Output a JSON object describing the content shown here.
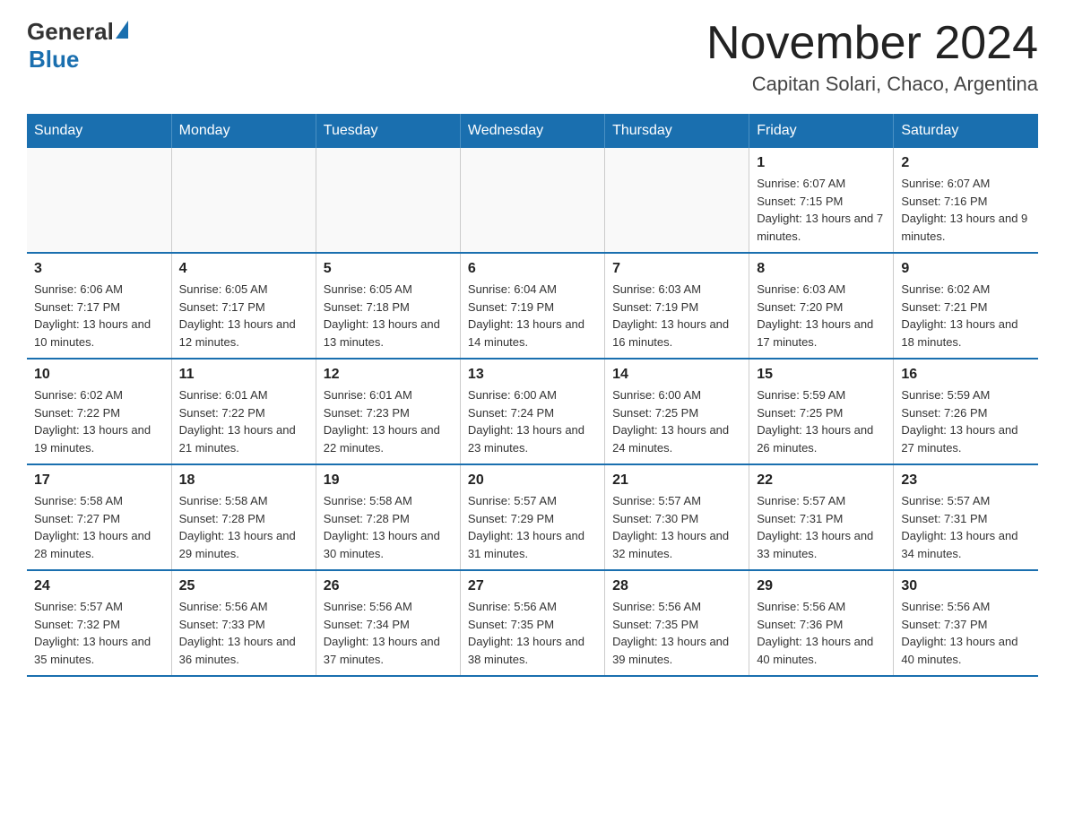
{
  "logo": {
    "general": "General",
    "blue": "Blue"
  },
  "title": "November 2024",
  "location": "Capitan Solari, Chaco, Argentina",
  "days_of_week": [
    "Sunday",
    "Monday",
    "Tuesday",
    "Wednesday",
    "Thursday",
    "Friday",
    "Saturday"
  ],
  "weeks": [
    [
      {
        "day": "",
        "info": ""
      },
      {
        "day": "",
        "info": ""
      },
      {
        "day": "",
        "info": ""
      },
      {
        "day": "",
        "info": ""
      },
      {
        "day": "",
        "info": ""
      },
      {
        "day": "1",
        "info": "Sunrise: 6:07 AM\nSunset: 7:15 PM\nDaylight: 13 hours and 7 minutes."
      },
      {
        "day": "2",
        "info": "Sunrise: 6:07 AM\nSunset: 7:16 PM\nDaylight: 13 hours and 9 minutes."
      }
    ],
    [
      {
        "day": "3",
        "info": "Sunrise: 6:06 AM\nSunset: 7:17 PM\nDaylight: 13 hours and 10 minutes."
      },
      {
        "day": "4",
        "info": "Sunrise: 6:05 AM\nSunset: 7:17 PM\nDaylight: 13 hours and 12 minutes."
      },
      {
        "day": "5",
        "info": "Sunrise: 6:05 AM\nSunset: 7:18 PM\nDaylight: 13 hours and 13 minutes."
      },
      {
        "day": "6",
        "info": "Sunrise: 6:04 AM\nSunset: 7:19 PM\nDaylight: 13 hours and 14 minutes."
      },
      {
        "day": "7",
        "info": "Sunrise: 6:03 AM\nSunset: 7:19 PM\nDaylight: 13 hours and 16 minutes."
      },
      {
        "day": "8",
        "info": "Sunrise: 6:03 AM\nSunset: 7:20 PM\nDaylight: 13 hours and 17 minutes."
      },
      {
        "day": "9",
        "info": "Sunrise: 6:02 AM\nSunset: 7:21 PM\nDaylight: 13 hours and 18 minutes."
      }
    ],
    [
      {
        "day": "10",
        "info": "Sunrise: 6:02 AM\nSunset: 7:22 PM\nDaylight: 13 hours and 19 minutes."
      },
      {
        "day": "11",
        "info": "Sunrise: 6:01 AM\nSunset: 7:22 PM\nDaylight: 13 hours and 21 minutes."
      },
      {
        "day": "12",
        "info": "Sunrise: 6:01 AM\nSunset: 7:23 PM\nDaylight: 13 hours and 22 minutes."
      },
      {
        "day": "13",
        "info": "Sunrise: 6:00 AM\nSunset: 7:24 PM\nDaylight: 13 hours and 23 minutes."
      },
      {
        "day": "14",
        "info": "Sunrise: 6:00 AM\nSunset: 7:25 PM\nDaylight: 13 hours and 24 minutes."
      },
      {
        "day": "15",
        "info": "Sunrise: 5:59 AM\nSunset: 7:25 PM\nDaylight: 13 hours and 26 minutes."
      },
      {
        "day": "16",
        "info": "Sunrise: 5:59 AM\nSunset: 7:26 PM\nDaylight: 13 hours and 27 minutes."
      }
    ],
    [
      {
        "day": "17",
        "info": "Sunrise: 5:58 AM\nSunset: 7:27 PM\nDaylight: 13 hours and 28 minutes."
      },
      {
        "day": "18",
        "info": "Sunrise: 5:58 AM\nSunset: 7:28 PM\nDaylight: 13 hours and 29 minutes."
      },
      {
        "day": "19",
        "info": "Sunrise: 5:58 AM\nSunset: 7:28 PM\nDaylight: 13 hours and 30 minutes."
      },
      {
        "day": "20",
        "info": "Sunrise: 5:57 AM\nSunset: 7:29 PM\nDaylight: 13 hours and 31 minutes."
      },
      {
        "day": "21",
        "info": "Sunrise: 5:57 AM\nSunset: 7:30 PM\nDaylight: 13 hours and 32 minutes."
      },
      {
        "day": "22",
        "info": "Sunrise: 5:57 AM\nSunset: 7:31 PM\nDaylight: 13 hours and 33 minutes."
      },
      {
        "day": "23",
        "info": "Sunrise: 5:57 AM\nSunset: 7:31 PM\nDaylight: 13 hours and 34 minutes."
      }
    ],
    [
      {
        "day": "24",
        "info": "Sunrise: 5:57 AM\nSunset: 7:32 PM\nDaylight: 13 hours and 35 minutes."
      },
      {
        "day": "25",
        "info": "Sunrise: 5:56 AM\nSunset: 7:33 PM\nDaylight: 13 hours and 36 minutes."
      },
      {
        "day": "26",
        "info": "Sunrise: 5:56 AM\nSunset: 7:34 PM\nDaylight: 13 hours and 37 minutes."
      },
      {
        "day": "27",
        "info": "Sunrise: 5:56 AM\nSunset: 7:35 PM\nDaylight: 13 hours and 38 minutes."
      },
      {
        "day": "28",
        "info": "Sunrise: 5:56 AM\nSunset: 7:35 PM\nDaylight: 13 hours and 39 minutes."
      },
      {
        "day": "29",
        "info": "Sunrise: 5:56 AM\nSunset: 7:36 PM\nDaylight: 13 hours and 40 minutes."
      },
      {
        "day": "30",
        "info": "Sunrise: 5:56 AM\nSunset: 7:37 PM\nDaylight: 13 hours and 40 minutes."
      }
    ]
  ]
}
